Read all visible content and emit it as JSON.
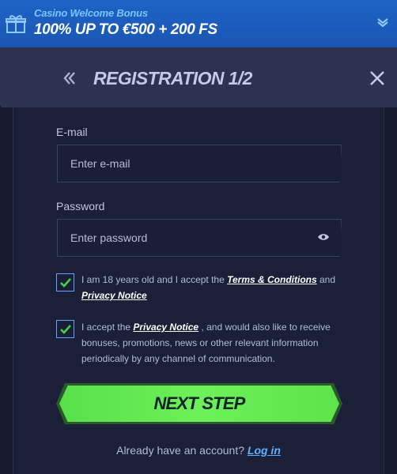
{
  "bonus": {
    "subtitle": "Casino Welcome Bonus",
    "headline": "100% UP TO €500 + 200 FS"
  },
  "header": {
    "title": "REGISTRATION 1/2"
  },
  "form": {
    "email": {
      "label": "E-mail",
      "placeholder": "Enter e-mail",
      "value": ""
    },
    "password": {
      "label": "Password",
      "placeholder": "Enter password",
      "value": ""
    },
    "terms": {
      "checked": true,
      "text_before": "I am 18 years old and I accept the ",
      "terms_link": "Terms & Conditions",
      "text_middle": " and ",
      "privacy_link": "Privacy Notice"
    },
    "marketing": {
      "checked": true,
      "text_before": "I accept the ",
      "privacy_link": "Privacy Notice",
      "text_after": " , and would also like to receive bonuses, promotions, news or other relevant information periodically by any channel of communication."
    },
    "next_label": "NEXT STEP"
  },
  "footer": {
    "prompt": "Already have an account? ",
    "login_link": "Log in"
  },
  "colors": {
    "accent_blue": "#1f63c6",
    "button_green": "#6df05a",
    "link_blue": "#5fb0ff",
    "background": "#161a2e"
  }
}
